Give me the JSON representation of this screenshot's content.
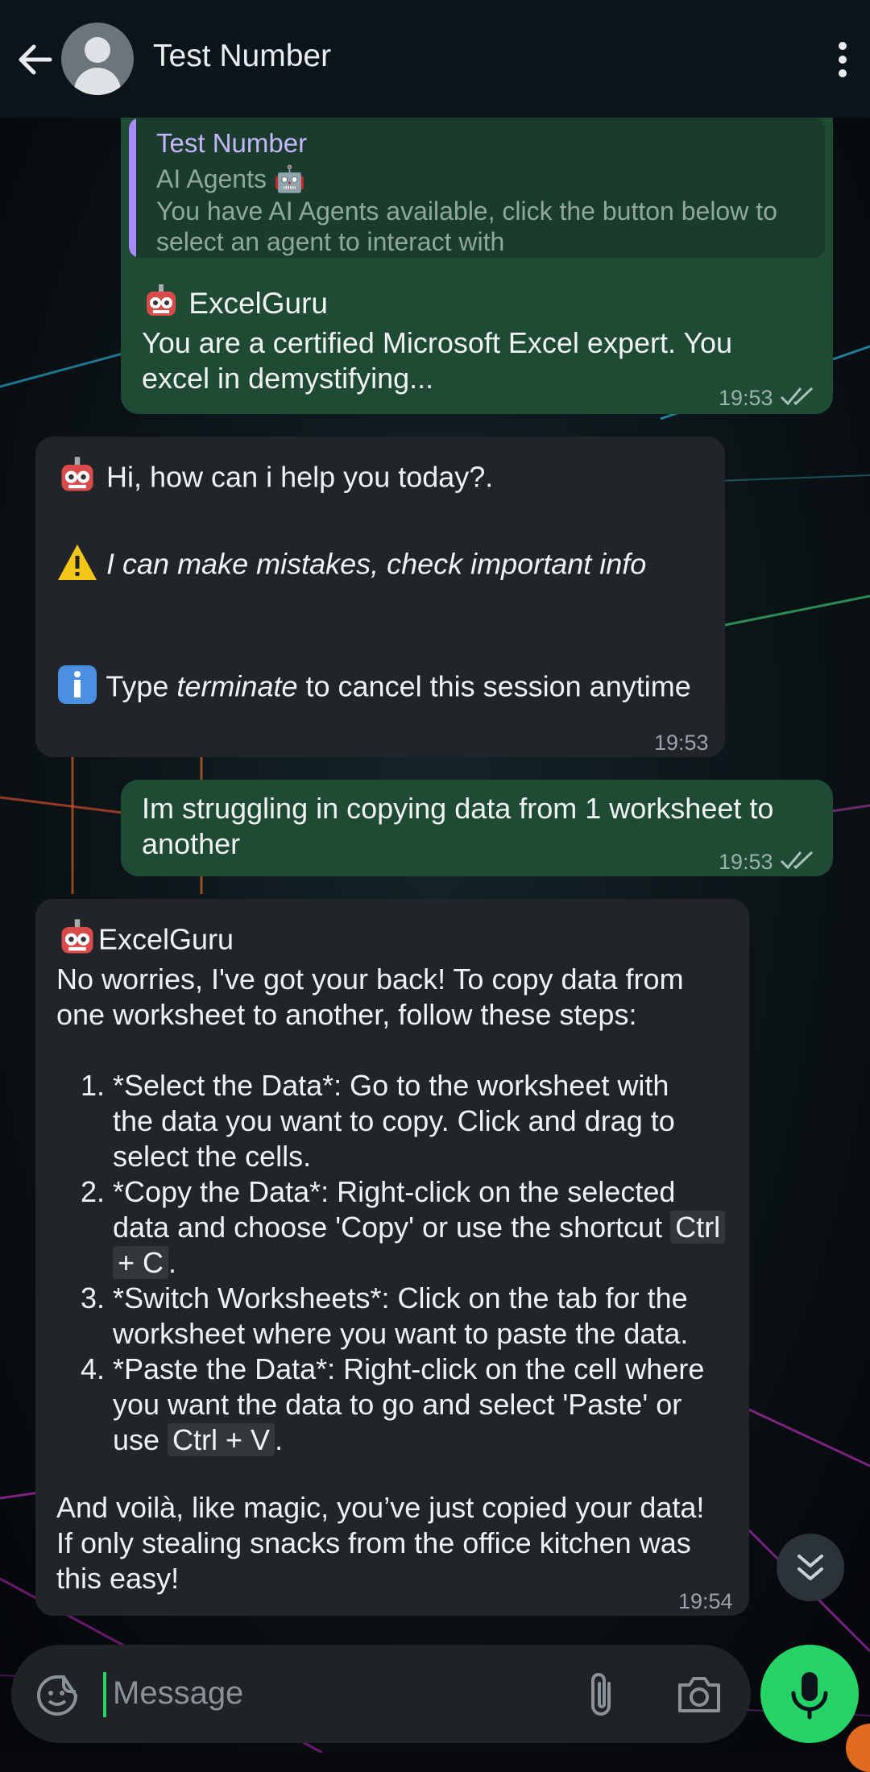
{
  "header": {
    "title": "Test Number",
    "back_icon": "arrow-left-icon",
    "menu_icon": "more-vert-icon"
  },
  "messages": [
    {
      "type": "outgoing",
      "quote": {
        "name": "Test Number",
        "line1": "AI Agents 🤖",
        "line2": "You have AI Agents available, click the button below to",
        "line3": "select an agent to interact with"
      },
      "agent_line": "ExcelGuru",
      "text_line1": "You are a certified Microsoft Excel expert. You",
      "text_line2": "excel in demystifying...",
      "time": "19:53"
    },
    {
      "type": "incoming",
      "greeting": "Hi, how can i help you today?.",
      "warning": "I can make mistakes, check important info",
      "info_prefix": "Type ",
      "info_keyword": "terminate",
      "info_suffix": " to cancel this session anytime",
      "time": "19:53"
    },
    {
      "type": "outgoing",
      "text_line1": "Im struggling in copying data from 1 worksheet to",
      "text_line2": "another",
      "time": "19:53"
    },
    {
      "type": "incoming",
      "agent": "ExcelGuru",
      "intro_line1": "No worries, I've got your back! To copy data from",
      "intro_line2": "one worksheet to another, follow these steps:",
      "steps": [
        {
          "a": "*Select the Data*: Go to the worksheet with",
          "b": "the data you want to copy. Click and drag to",
          "c": "select the cells."
        },
        {
          "a": "*Copy the Data*: Right-click on the selected",
          "b": "data and choose 'Copy' or use the shortcut ",
          "code1": "Ctrl",
          "code2": "+ C",
          "end": "."
        },
        {
          "a": "*Switch Worksheets*: Click on the tab for the",
          "b": "worksheet where you want to paste the data."
        },
        {
          "a": "*Paste the Data*: Right-click on the cell where",
          "b": "you want the data to go and select 'Paste' or",
          "c_pre": "use ",
          "code": "Ctrl + V",
          "end": "."
        }
      ],
      "outro_line1": "And voilà, like magic, you’ve just copied your data!",
      "outro_line2": "If only stealing snacks from the office kitchen was",
      "outro_line3": "this easy!",
      "time": "19:54"
    }
  ],
  "composer": {
    "placeholder": "Message",
    "emoji_icon": "sticker-icon",
    "attach_icon": "paperclip-icon",
    "camera_icon": "camera-icon",
    "mic_icon": "mic-icon"
  },
  "colors": {
    "outgoing_bubble": "#1f4a34",
    "incoming_bubble": "#212429",
    "accent": "#25d366"
  }
}
